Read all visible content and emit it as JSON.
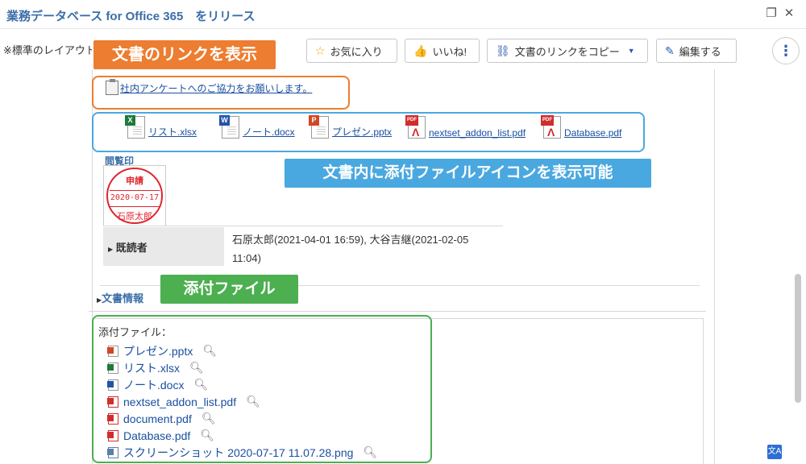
{
  "window": {
    "title": "業務データベース for Office 365　をリリース",
    "restore_icon": "restore-icon",
    "close_icon": "close-icon"
  },
  "toolbar": {
    "layout_label": "※標準のレイアウト",
    "favorite_label": "お気に入り",
    "like_label": "いいね!",
    "copy_link_label": "文書のリンクをコピー",
    "edit_label": "編集する",
    "more_icon": "kebab-menu-icon"
  },
  "callouts": {
    "show_link": "文書のリンクを表示",
    "show_icons": "文書内に添付ファイルアイコンを表示可能",
    "attachments": "添付ファイル"
  },
  "document": {
    "survey_link": "社内アンケートへのご協力をお願いします。",
    "inline_files": [
      {
        "name": "リスト.xlsx",
        "type": "xlsx"
      },
      {
        "name": "ノート.docx",
        "type": "docx"
      },
      {
        "name": "プレゼン.pptx",
        "type": "pptx"
      },
      {
        "name": "nextset_addon_list.pdf",
        "type": "pdf"
      },
      {
        "name": "Database.pdf",
        "type": "pdf"
      }
    ],
    "stamp_section_label": "閲覧印",
    "stamp": {
      "line1": "申請",
      "line2": "2020-07-17",
      "line3": "石原太郎"
    },
    "readers_label": "既読者",
    "readers_value": "石原太郎(2021-04-01 16:59), 大谷吉継(2021-02-05 11:04)",
    "doc_info_label": "文書情報"
  },
  "attachments": {
    "label": "添付ファイル：",
    "items": [
      {
        "name": "プレゼン.pptx",
        "type": "pptx"
      },
      {
        "name": "リスト.xlsx",
        "type": "xlsx"
      },
      {
        "name": "ノート.docx",
        "type": "docx"
      },
      {
        "name": "nextset_addon_list.pdf",
        "type": "pdf"
      },
      {
        "name": "document.pdf",
        "type": "pdf"
      },
      {
        "name": "Database.pdf",
        "type": "pdf"
      },
      {
        "name": "スクリーンショット 2020-07-17 11.07.28.png",
        "type": "png"
      }
    ]
  },
  "colors": {
    "title": "#3a6ea8",
    "callout_orange": "#ec7d31",
    "callout_blue": "#4aa8e0",
    "callout_green": "#4caf50",
    "link": "#1a4fa0",
    "stamp_red": "#e0242c"
  }
}
